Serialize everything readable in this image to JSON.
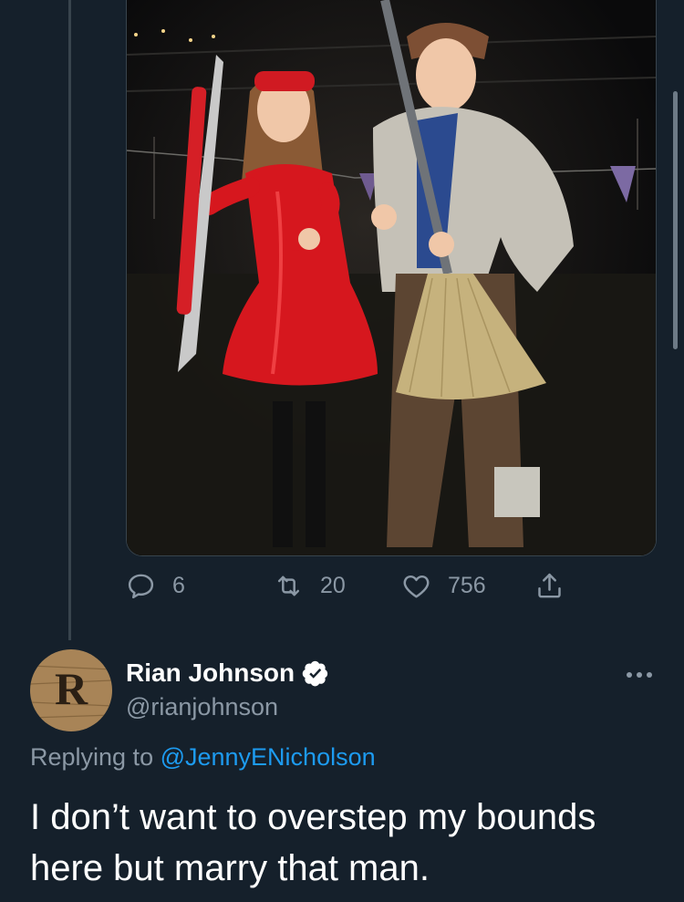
{
  "tweet_photo": {
    "alt": "Two people in costumes at night"
  },
  "actions": {
    "replies": "6",
    "retweets": "20",
    "likes": "756"
  },
  "reply_tweet": {
    "avatar_letter": "R",
    "display_name": "Rian Johnson",
    "handle": "@rianjohnson",
    "replying_prefix": "Replying to ",
    "replying_to": "@JennyENicholson",
    "text": "I don’t want to overstep my bounds here but marry that man."
  },
  "colors": {
    "background": "#15202b",
    "secondary_text": "#8b98a5",
    "link": "#1d9bf0",
    "divider": "#38444d"
  },
  "icons": [
    "reply-icon",
    "retweet-icon",
    "like-icon",
    "share-icon",
    "verified-badge-icon",
    "more-options-icon"
  ]
}
